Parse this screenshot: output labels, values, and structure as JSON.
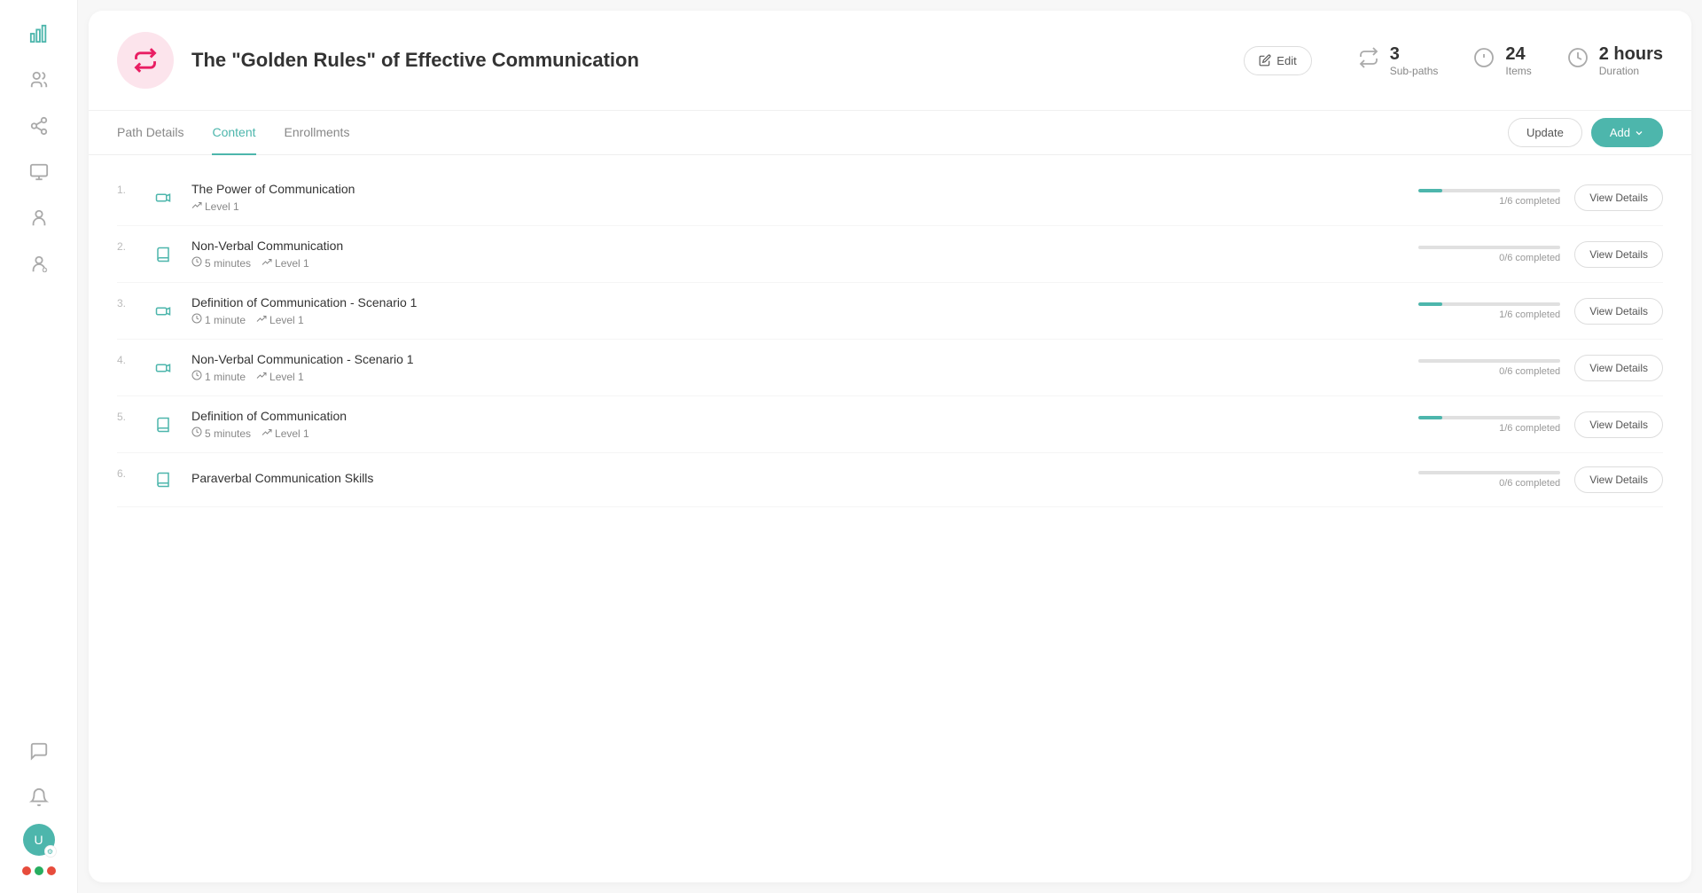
{
  "sidebar": {
    "icons": [
      {
        "name": "analytics-icon",
        "symbol": "📊"
      },
      {
        "name": "users-icon",
        "symbol": "👥"
      },
      {
        "name": "paths-icon",
        "symbol": "🔀"
      },
      {
        "name": "courses-icon",
        "symbol": "📋"
      },
      {
        "name": "learners-icon",
        "symbol": "👤"
      },
      {
        "name": "instructors-icon",
        "symbol": "✏️"
      },
      {
        "name": "chat-icon",
        "symbol": "💬"
      },
      {
        "name": "notifications-icon",
        "symbol": "🔔"
      }
    ],
    "avatarLabel": "U",
    "colorDots": [
      "#e74c3c",
      "#27ae60",
      "#e74c3c"
    ]
  },
  "header": {
    "pathAvatarSymbol": "⇄",
    "title": "The \"Golden Rules\" of Effective Communication",
    "editLabel": "Edit",
    "stats": [
      {
        "number": "3",
        "label": "Sub-paths"
      },
      {
        "number": "24",
        "label": "Items"
      },
      {
        "number": "2 hours",
        "label": "Duration"
      }
    ]
  },
  "tabs": {
    "items": [
      {
        "label": "Path Details",
        "active": false
      },
      {
        "label": "Content",
        "active": true
      },
      {
        "label": "Enrollments",
        "active": false
      }
    ],
    "updateLabel": "Update",
    "addLabel": "Add"
  },
  "contentList": [
    {
      "number": "1.",
      "type": "video",
      "title": "The Power of Communication",
      "meta": [
        {
          "icon": "📈",
          "text": "Level 1"
        }
      ],
      "progressPercent": 17,
      "progressLabel": "1/6 completed",
      "viewDetailsLabel": "View Details"
    },
    {
      "number": "2.",
      "type": "book",
      "title": "Non-Verbal Communication",
      "meta": [
        {
          "icon": "⏱",
          "text": "5 minutes"
        },
        {
          "icon": "📈",
          "text": "Level 1"
        }
      ],
      "progressPercent": 0,
      "progressLabel": "0/6 completed",
      "viewDetailsLabel": "View Details"
    },
    {
      "number": "3.",
      "type": "video",
      "title": "Definition of Communication - Scenario 1",
      "meta": [
        {
          "icon": "⏱",
          "text": "1 minute"
        },
        {
          "icon": "📈",
          "text": "Level 1"
        }
      ],
      "progressPercent": 17,
      "progressLabel": "1/6 completed",
      "viewDetailsLabel": "View Details"
    },
    {
      "number": "4.",
      "type": "video",
      "title": "Non-Verbal Communication - Scenario 1",
      "meta": [
        {
          "icon": "⏱",
          "text": "1 minute"
        },
        {
          "icon": "📈",
          "text": "Level 1"
        }
      ],
      "progressPercent": 0,
      "progressLabel": "0/6 completed",
      "viewDetailsLabel": "View Details"
    },
    {
      "number": "5.",
      "type": "book",
      "title": "Definition of Communication",
      "meta": [
        {
          "icon": "⏱",
          "text": "5 minutes"
        },
        {
          "icon": "📈",
          "text": "Level 1"
        }
      ],
      "progressPercent": 17,
      "progressLabel": "1/6 completed",
      "viewDetailsLabel": "View Details"
    },
    {
      "number": "6.",
      "type": "book",
      "title": "Paraverbal Communication Skills",
      "meta": [],
      "progressPercent": 0,
      "progressLabel": "0/6 completed",
      "viewDetailsLabel": "View Details"
    }
  ]
}
